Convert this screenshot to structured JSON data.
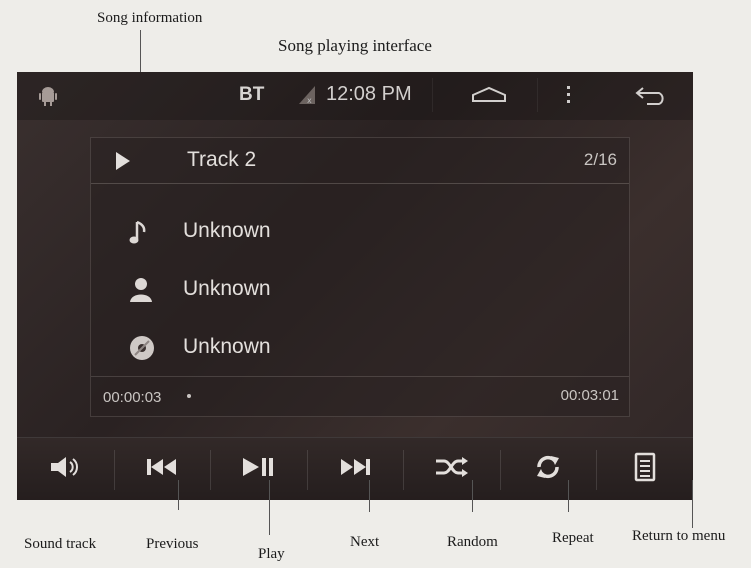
{
  "annotations": {
    "song_information": "Song information",
    "interface_title": "Song playing interface",
    "sound_track": "Sound track",
    "previous": "Previous",
    "play": "Play",
    "next": "Next",
    "random": "Random",
    "repeat": "Repeat",
    "return_to_menu": "Return to menu"
  },
  "status_bar": {
    "bt": "BT",
    "time": "12:08 PM"
  },
  "player": {
    "track_name": "Track 2",
    "track_count": "2/16",
    "title": "Unknown",
    "artist": "Unknown",
    "album": "Unknown",
    "elapsed": "00:00:03",
    "total": "00:03:01"
  },
  "icons": {
    "android": "android-icon",
    "signal": "signal-icon",
    "home": "home-icon",
    "menu": "menu-dots-icon",
    "back": "back-icon",
    "note": "music-note-icon",
    "artist": "person-icon",
    "album": "disc-icon"
  },
  "colors": {
    "accent": "#e3dfdc",
    "screen_bg": "#2f2626"
  }
}
